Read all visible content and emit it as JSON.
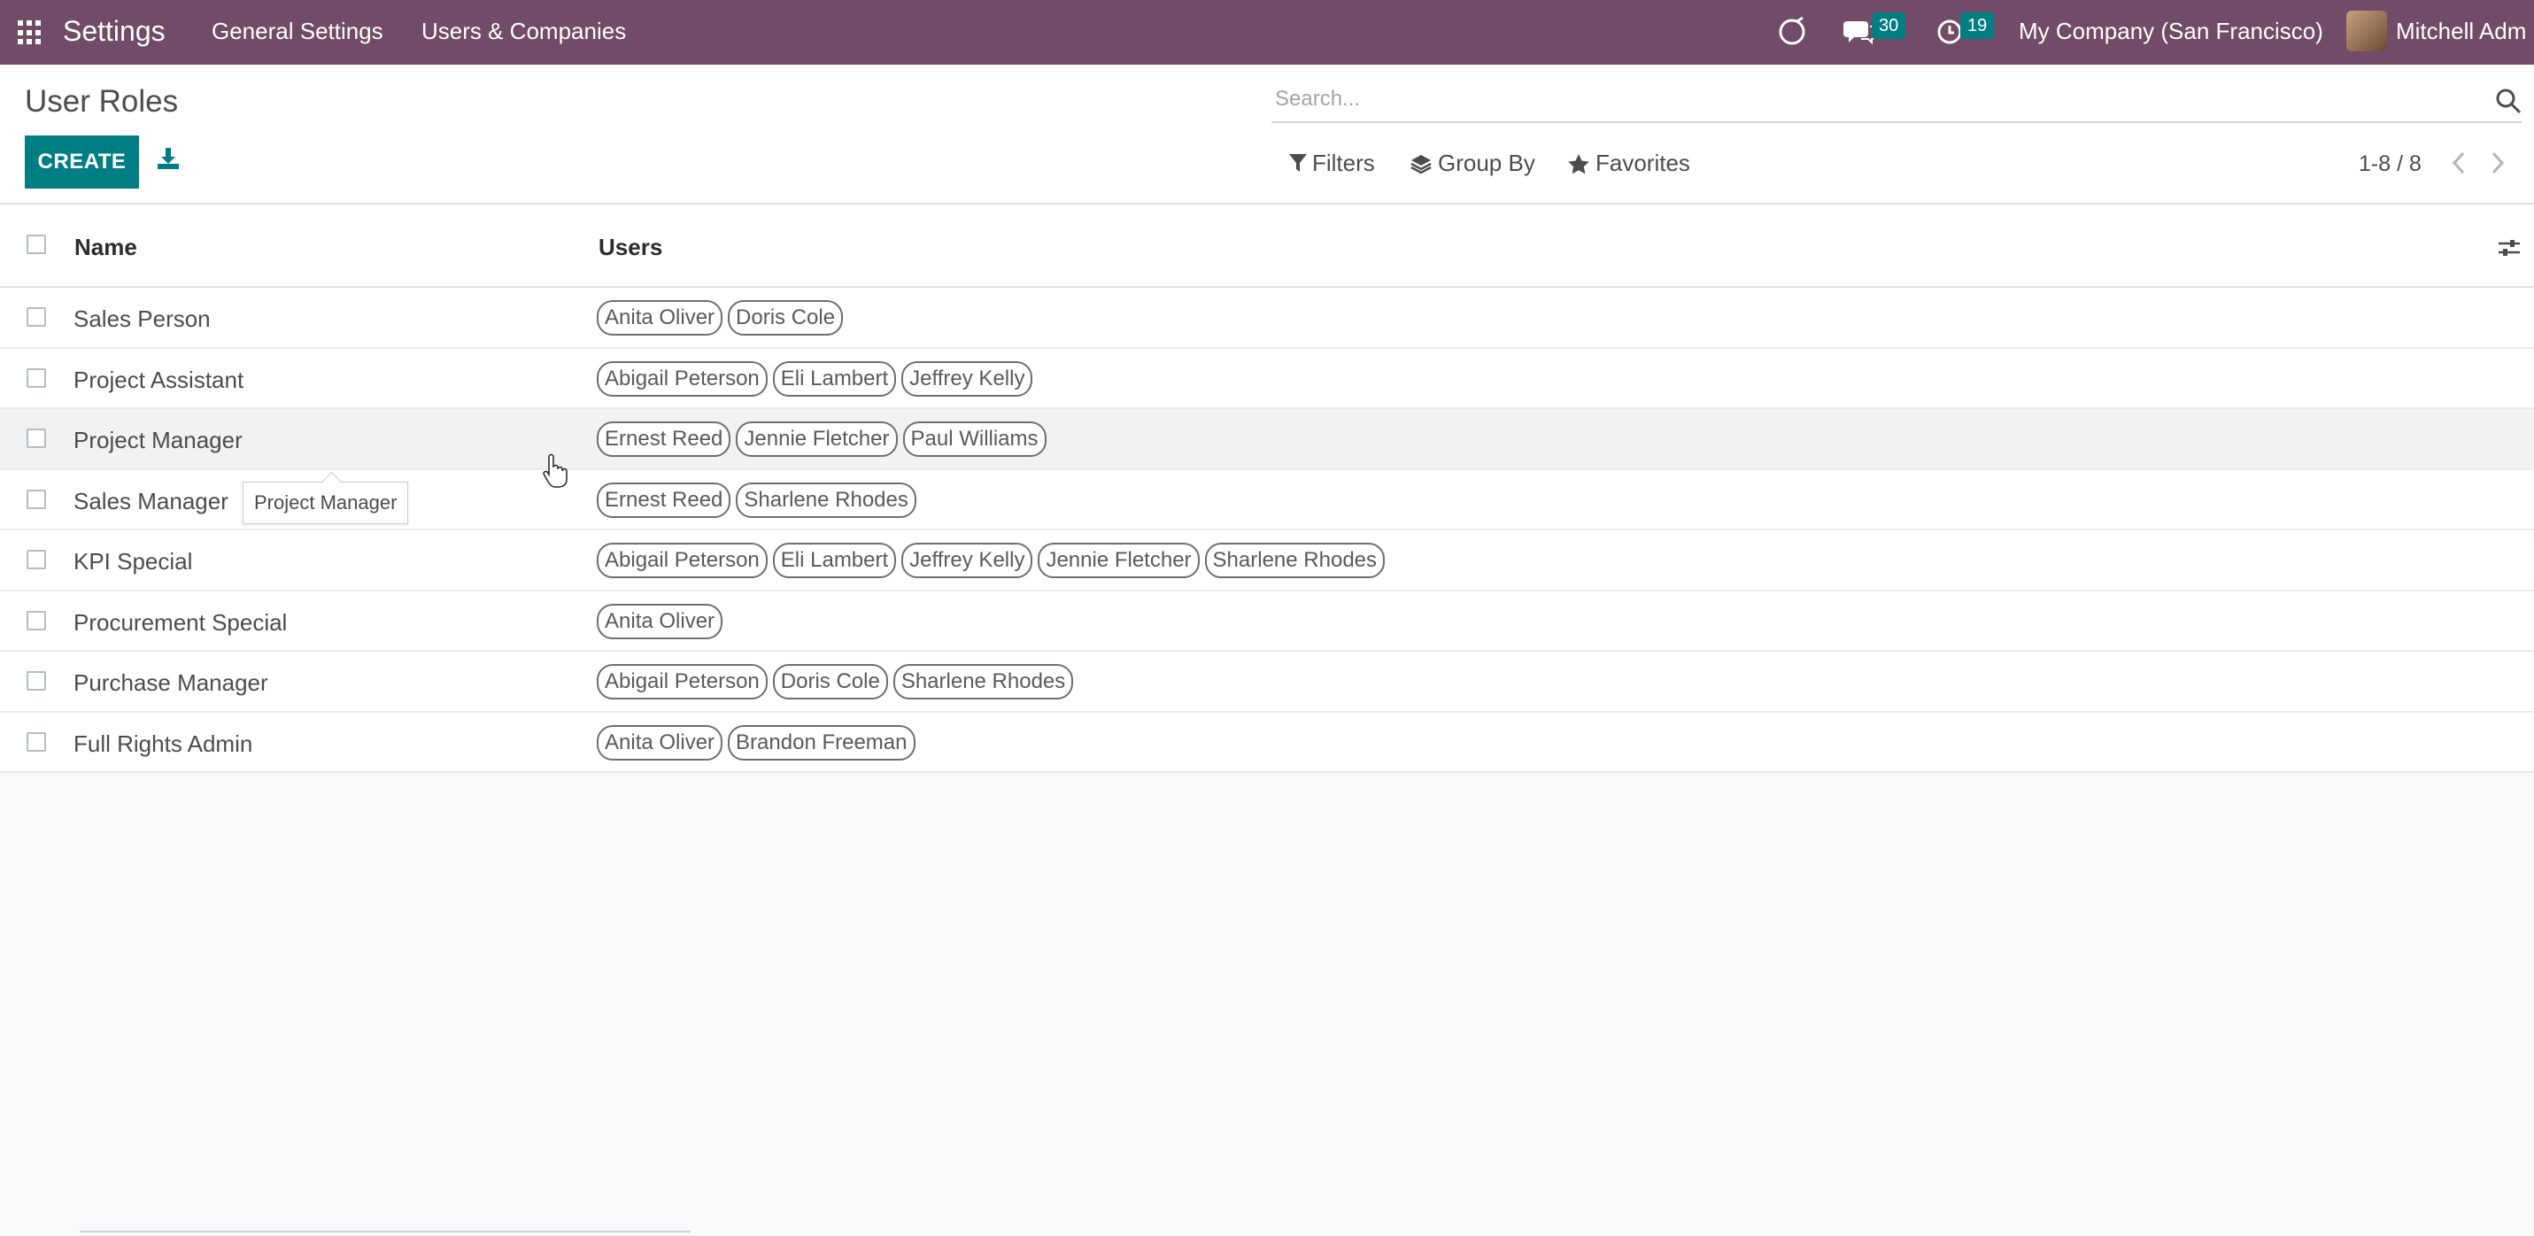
{
  "navbar": {
    "brand": "Settings",
    "menus": [
      "General Settings",
      "Users & Companies"
    ],
    "messages_count": "30",
    "activities_count": "19",
    "company": "My Company (San Francisco)",
    "user": "Mitchell Adm",
    "color": "#714b67"
  },
  "control": {
    "title": "User Roles",
    "create_label": "CREATE",
    "search_placeholder": "Search...",
    "filters_label": "Filters",
    "groupby_label": "Group By",
    "favorites_label": "Favorites",
    "pager": "1-8 / 8",
    "accent": "#017e84"
  },
  "list": {
    "columns": [
      "Name",
      "Users"
    ],
    "rows": [
      {
        "name": "Sales Person",
        "users": [
          "Anita Oliver",
          "Doris Cole"
        ]
      },
      {
        "name": "Project Assistant",
        "users": [
          "Abigail Peterson",
          "Eli Lambert",
          "Jeffrey Kelly"
        ]
      },
      {
        "name": "Project Manager",
        "users": [
          "Ernest Reed",
          "Jennie Fletcher",
          "Paul Williams"
        ]
      },
      {
        "name": "Sales Manager",
        "users": [
          "Ernest Reed",
          "Sharlene Rhodes"
        ]
      },
      {
        "name": "KPI Special",
        "users": [
          "Abigail Peterson",
          "Eli Lambert",
          "Jeffrey Kelly",
          "Jennie Fletcher",
          "Sharlene Rhodes"
        ]
      },
      {
        "name": "Procurement Special",
        "users": [
          "Anita Oliver"
        ]
      },
      {
        "name": "Purchase Manager",
        "users": [
          "Abigail Peterson",
          "Doris Cole",
          "Sharlene Rhodes"
        ]
      },
      {
        "name": "Full Rights Admin",
        "users": [
          "Anita Oliver",
          "Brandon Freeman"
        ]
      }
    ]
  },
  "tooltip": "Project Manager"
}
